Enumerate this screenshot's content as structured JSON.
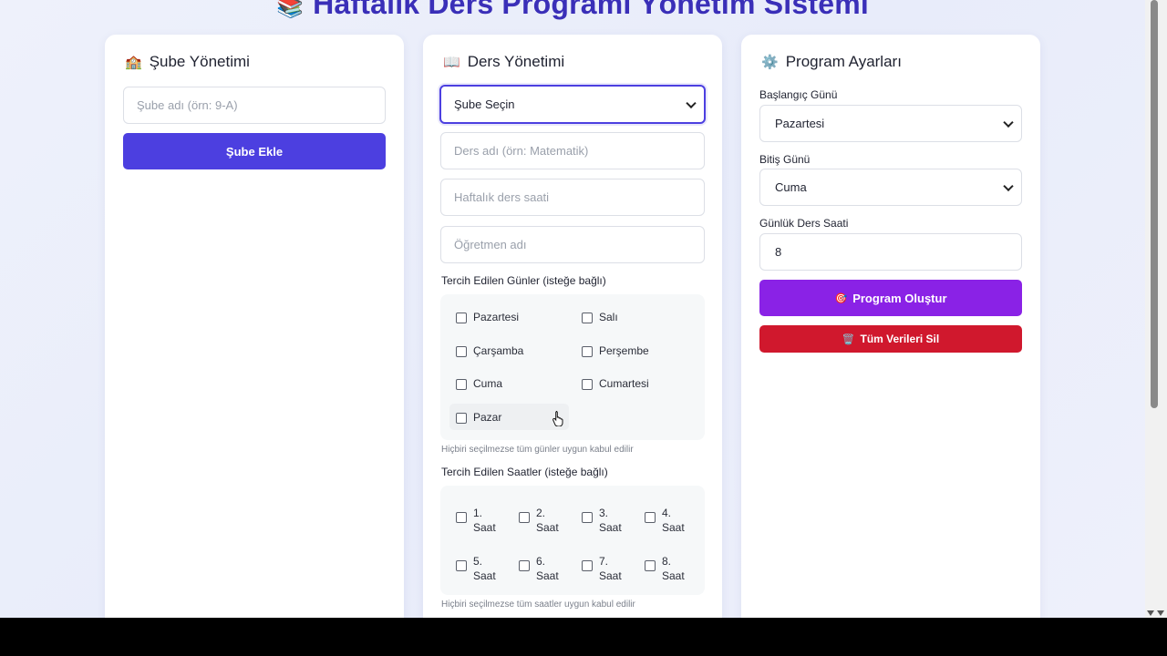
{
  "page": {
    "title_icon": "books-icon",
    "title": "Haftalık Ders Programı Yönetim Sistemi"
  },
  "branch_card": {
    "icon": "school-icon",
    "heading": "Şube Yönetimi",
    "name_placeholder": "Şube adı (örn: 9-A)",
    "add_button": "Şube Ekle"
  },
  "course_card": {
    "icon": "book-icon",
    "heading": "Ders Yönetimi",
    "branch_select_value": "Şube Seçin",
    "course_placeholder": "Ders adı (örn: Matematik)",
    "hours_placeholder": "Haftalık ders saati",
    "teacher_placeholder": "Öğretmen adı",
    "days_label": "Tercih Edilen Günler (isteğe bağlı)",
    "days": [
      "Pazartesi",
      "Salı",
      "Çarşamba",
      "Perşembe",
      "Cuma",
      "Cumartesi",
      "Pazar"
    ],
    "days_hint": "Hiçbiri seçilmezse tüm günler uygun kabul edilir",
    "hours_label": "Tercih Edilen Saatler (isteğe bağlı)",
    "hours": [
      {
        "num": "1.",
        "unit": "Saat"
      },
      {
        "num": "2.",
        "unit": "Saat"
      },
      {
        "num": "3.",
        "unit": "Saat"
      },
      {
        "num": "4.",
        "unit": "Saat"
      },
      {
        "num": "5.",
        "unit": "Saat"
      },
      {
        "num": "6.",
        "unit": "Saat"
      },
      {
        "num": "7.",
        "unit": "Saat"
      },
      {
        "num": "8.",
        "unit": "Saat"
      }
    ],
    "hours_hint": "Hiçbiri seçilmezse tüm saatler uygun kabul edilir"
  },
  "settings_card": {
    "icon": "gear-icon",
    "heading": "Program Ayarları",
    "start_day_label": "Başlangıç Günü",
    "start_day_value": "Pazartesi",
    "end_day_label": "Bitiş Günü",
    "end_day_value": "Cuma",
    "daily_hours_label": "Günlük Ders Saati",
    "daily_hours_value": "8",
    "generate_button_icon": "target-icon",
    "generate_button": "Program Oluştur",
    "delete_button_icon": "trash-icon",
    "delete_button": "Tüm Verileri Sil"
  },
  "colors": {
    "primary": "#4c3fe0",
    "generate": "#8a22e6",
    "danger": "#d0182d",
    "title": "#3a2fb8"
  }
}
